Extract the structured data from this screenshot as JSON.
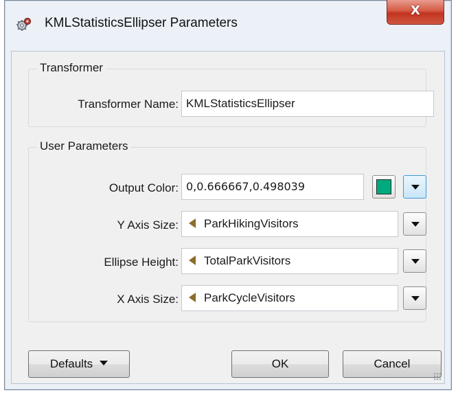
{
  "window": {
    "title": "KMLStatisticsEllipser Parameters",
    "close_label": "X",
    "icon": "gears-icon"
  },
  "transformer_group": {
    "title": "Transformer",
    "name_label": "Transformer Name:",
    "name_value": "KMLStatisticsEllipser"
  },
  "user_params_group": {
    "title": "User Parameters",
    "rows": [
      {
        "label": "Output Color:",
        "value": "0,0.666667,0.498039",
        "swatch_color": "#00aa7f"
      },
      {
        "label": "Y Axis Size:",
        "value": "ParkHikingVisitors",
        "icon": "attribute-icon"
      },
      {
        "label": "Ellipse Height:",
        "value": "TotalParkVisitors",
        "icon": "attribute-icon"
      },
      {
        "label": "X Axis Size:",
        "value": "ParkCycleVisitors",
        "icon": "attribute-icon"
      }
    ]
  },
  "footer": {
    "defaults_label": "Defaults",
    "ok_label": "OK",
    "cancel_label": "Cancel"
  },
  "colors": {
    "swatch": "#00aa7f",
    "attr_icon": "#8a6d2a",
    "close_red": "#c2341f"
  }
}
